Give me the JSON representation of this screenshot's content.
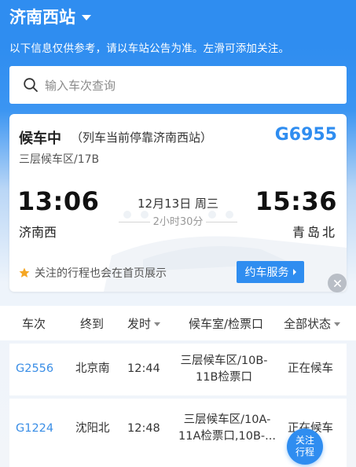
{
  "header": {
    "station": "济南西站",
    "notice": "以下信息仅供参考，请以车站公告为准。左滑可添加关注。"
  },
  "search": {
    "placeholder": "输入车次查询"
  },
  "card": {
    "status": "候车中",
    "status_detail": "（列车当前停靠济南西站）",
    "train_no": "G6955",
    "waiting_area": "三层候车区/17B",
    "depart_time": "13:06",
    "depart_station": "济南西",
    "date": "12月13日 周三",
    "duration": "2小时30分",
    "arrive_time": "15:36",
    "arrive_station": "青岛北",
    "follow_note": "关注的行程也会在首页展示",
    "service_button": "约车服务"
  },
  "table": {
    "headers": [
      "车次",
      "终到",
      "发时",
      "候车室/检票口",
      "全部状态"
    ],
    "rows": [
      {
        "train": "G2556",
        "terminal": "北京南",
        "time": "12:44",
        "gate_line1": "三层候车区/10B-",
        "gate_line2": "11B检票口",
        "status": "正在候车"
      },
      {
        "train": "G1224",
        "terminal": "沈阳北",
        "time": "12:48",
        "gate_line1": "三层候车区/10A-",
        "gate_line2": "11A检票口,10B-...",
        "status": "正在候车"
      }
    ]
  },
  "fab": {
    "line1": "关注",
    "line2": "行程"
  },
  "colors": {
    "accent": "#2f8df0",
    "train_link": "#3a8ee6",
    "star": "#f5a623"
  },
  "icons": [
    "chevron-down-icon",
    "search-icon",
    "star-icon",
    "chevron-right-icon",
    "close-icon"
  ]
}
